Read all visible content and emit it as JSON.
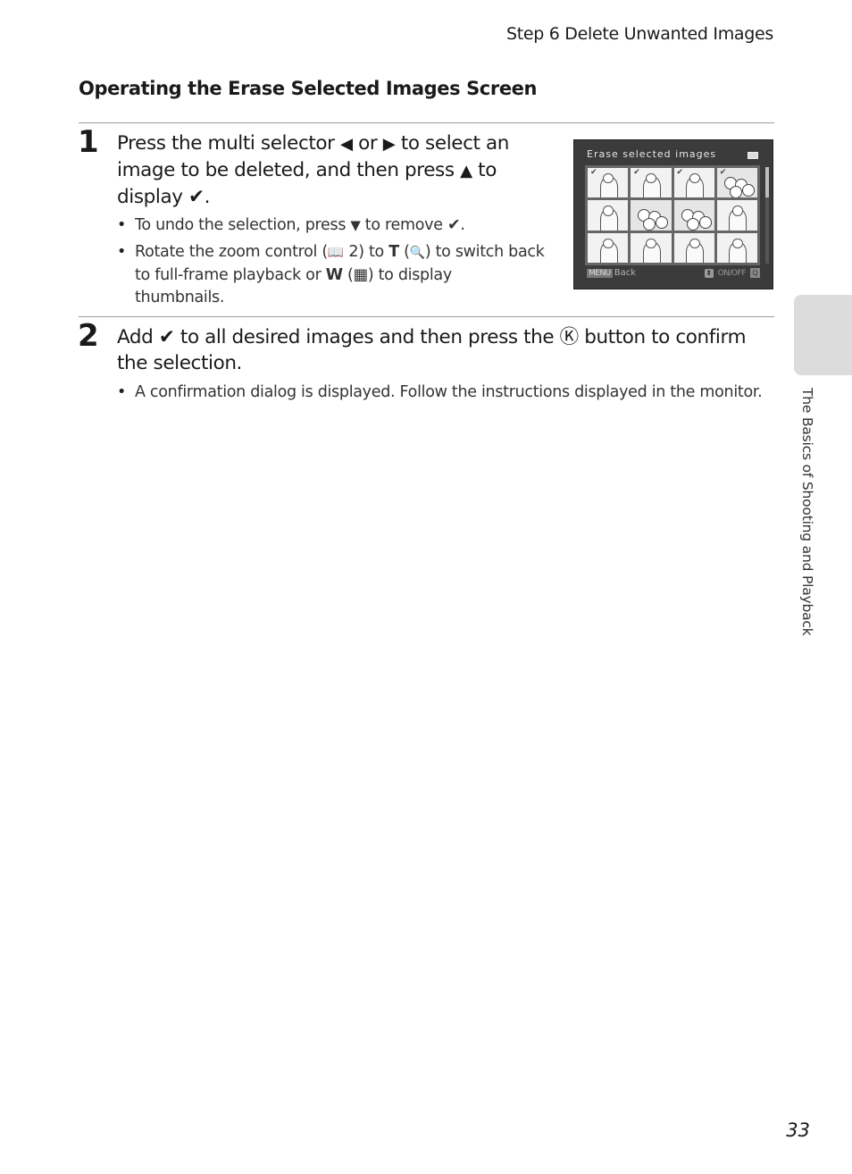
{
  "running_head": "Step 6 Delete Unwanted Images",
  "section_title": "Operating the Erase Selected Images Screen",
  "step1": {
    "number": "1",
    "text_parts": [
      "Press the multi selector ",
      " or ",
      " to select an image to be deleted, and then press ",
      " to display ",
      "."
    ],
    "icons": [
      "left-arrow",
      "right-arrow",
      "up-arrow",
      "check-mark"
    ],
    "bullets": [
      {
        "parts": [
          "To undo the selection, press ",
          " to remove ",
          "."
        ],
        "icons": [
          "down-arrow",
          "check-mark"
        ]
      },
      {
        "parts": [
          "Rotate the zoom control (",
          " 2) to ",
          " (",
          ") to switch back to full-frame playback or ",
          " (",
          ") to display thumbnails."
        ],
        "labels": {
          "t": "T",
          "w": "W"
        },
        "icons": [
          "book-ref",
          "T",
          "magnify",
          "W",
          "thumbnail"
        ]
      }
    ]
  },
  "step2": {
    "number": "2",
    "text_parts": [
      "Add ",
      " to all desired images and then press the ",
      " button to confirm the selection."
    ],
    "icons": [
      "check-mark",
      "ok-button"
    ],
    "bullets": [
      {
        "text": "A confirmation dialog is displayed. Follow the instructions displayed in the monitor."
      }
    ]
  },
  "camera_screen": {
    "title": "Erase selected images",
    "battery_icon": "battery-full",
    "thumbnails": [
      {
        "type": "portrait",
        "selected": true
      },
      {
        "type": "mother-child",
        "selected": true
      },
      {
        "type": "family",
        "selected": true
      },
      {
        "type": "flowers",
        "selected": true
      },
      {
        "type": "portrait",
        "selected": false
      },
      {
        "type": "flowers",
        "selected": false
      },
      {
        "type": "flowers",
        "selected": false
      },
      {
        "type": "mother-child",
        "selected": false
      },
      {
        "type": "mother-child",
        "selected": false
      },
      {
        "type": "family",
        "selected": false
      },
      {
        "type": "portrait",
        "selected": false
      },
      {
        "type": "portrait",
        "selected": false
      }
    ],
    "footer": {
      "menu_label": "MENU",
      "back_label": "Back",
      "onoff_label": "ON/OFF"
    }
  },
  "glyphs": {
    "left": "◀",
    "right": "▶",
    "up": "▲",
    "down": "▼",
    "check": "✔",
    "ok": "Ⓚ",
    "book": "📖",
    "magnify": "🔍",
    "thumbs": "▦",
    "ud": "⬍",
    "mag_small": "🔍"
  },
  "side_label": "The Basics of Shooting and Playback",
  "page_number": "33"
}
